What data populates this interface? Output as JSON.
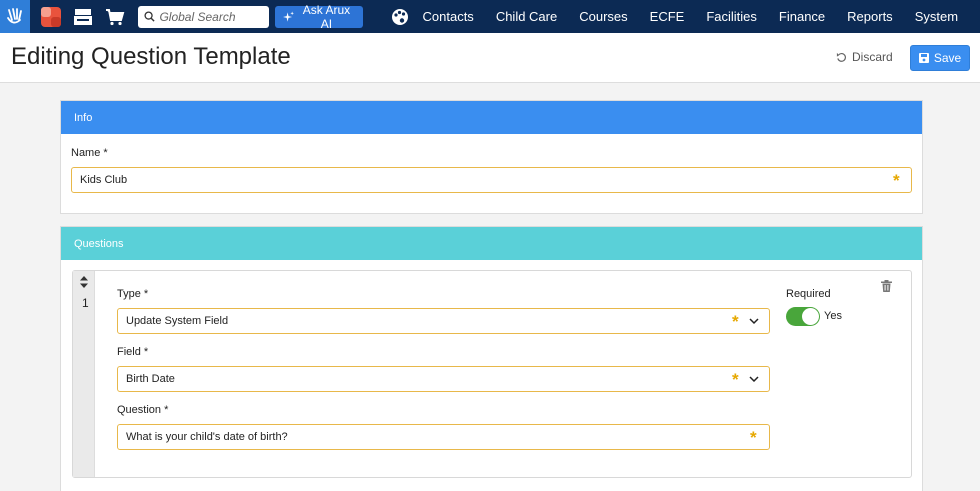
{
  "nav": {
    "search_placeholder": "Global Search",
    "ai_button": "Ask Arux AI",
    "menu": [
      "Contacts",
      "Child Care",
      "Courses",
      "ECFE",
      "Facilities",
      "Finance",
      "Reports",
      "System"
    ],
    "colors": {
      "bar": "#0c2a54",
      "logo_bg": "#2f7ed8",
      "ai_button": "#2d74d6"
    },
    "icons": [
      "hands-logo-icon",
      "app-tile-icon",
      "cash-register-icon",
      "cart-icon",
      "search-icon",
      "sparkle-icon",
      "palette-icon"
    ]
  },
  "header": {
    "title": "Editing Question Template",
    "discard_label": "Discard",
    "save_label": "Save"
  },
  "info": {
    "title": "Info",
    "name_label": "Name *",
    "name_value": "Kids Club"
  },
  "questions": {
    "title": "Questions",
    "items": [
      {
        "number": "1",
        "type_label": "Type *",
        "type_value": "Update System Field",
        "field_label": "Field *",
        "field_value": "Birth Date",
        "question_label": "Question *",
        "question_value": "What is your child's date of birth?",
        "required_label": "Required",
        "required_value": "Yes",
        "required_on": true
      }
    ]
  },
  "colors": {
    "info_header": "#3a8ef0",
    "questions_header": "#5ad0d8",
    "required_star": "#e6a800",
    "input_border": "#e8b84a",
    "toggle_on": "#49a63b",
    "save_button": "#3a8ef0"
  }
}
